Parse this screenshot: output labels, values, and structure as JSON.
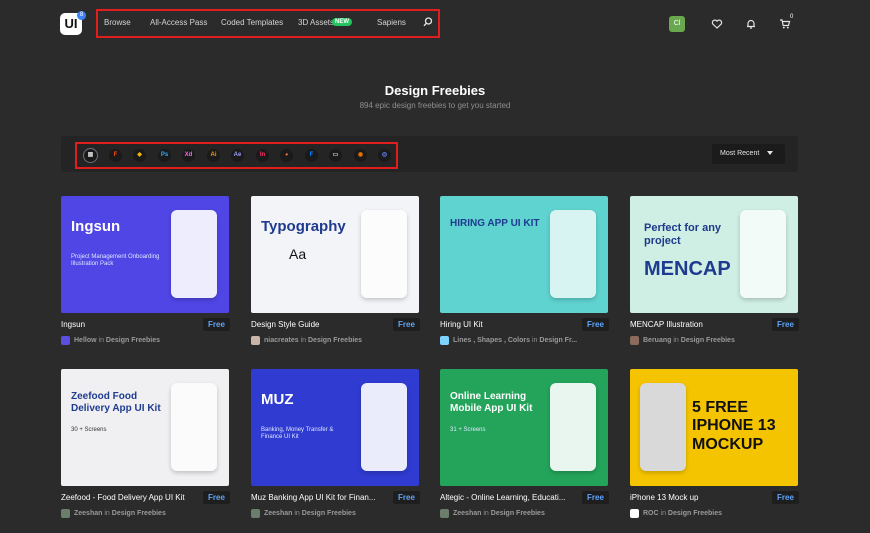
{
  "header": {
    "logo_text": "UI",
    "logo_badge": "8",
    "nav": [
      {
        "label": "Browse"
      },
      {
        "label": "All-Access Pass"
      },
      {
        "label": "Coded Templates"
      },
      {
        "label": "3D Assets"
      },
      {
        "label": "Sapiens"
      }
    ],
    "new_badge": "NEW",
    "search_icon": "search-icon",
    "avatar_initials": "Cl",
    "cart_count": "0",
    "icons": [
      "heart-icon",
      "bell-icon",
      "cart-icon"
    ]
  },
  "hero": {
    "title": "Design Freebies",
    "subtitle": "894 epic design freebies to get you started"
  },
  "filters": {
    "items": [
      {
        "icon": "grid-icon",
        "glyph": "▦",
        "color": "#cfcfcf"
      },
      {
        "icon": "figma-icon",
        "glyph": "F",
        "color": "#f24e1e"
      },
      {
        "icon": "sketch-icon",
        "glyph": "◆",
        "color": "#f7b500"
      },
      {
        "icon": "photoshop-icon",
        "glyph": "Ps",
        "color": "#31a8ff"
      },
      {
        "icon": "xd-icon",
        "glyph": "Xd",
        "color": "#ff61f6"
      },
      {
        "icon": "illustrator-icon",
        "glyph": "Ai",
        "color": "#ff9a00"
      },
      {
        "icon": "after-effects-icon",
        "glyph": "Ae",
        "color": "#9999ff"
      },
      {
        "icon": "invision-icon",
        "glyph": "In",
        "color": "#ff3366"
      },
      {
        "icon": "pie-icon",
        "glyph": "◕",
        "color": "#ff7a45"
      },
      {
        "icon": "framer-icon",
        "glyph": "F",
        "color": "#0a84ff"
      },
      {
        "icon": "monitor-icon",
        "glyph": "▭",
        "color": "#cfcfcf"
      },
      {
        "icon": "blender-icon",
        "glyph": "◉",
        "color": "#ea7600"
      },
      {
        "icon": "circle-logo-icon",
        "glyph": "◎",
        "color": "#6b8cff"
      }
    ],
    "sort_label": "Most Recent"
  },
  "cards": [
    {
      "title": "Ingsun",
      "price": "Free",
      "author": "Hellow",
      "in_word": "in",
      "category": "Design Freebies",
      "bg": "#4f46e5",
      "avatar_color": "#5b4fe0",
      "thumb_text": "Ingsun",
      "thumb_sub": "Project Management Onboarding Illustration Pack"
    },
    {
      "title": "Design Style Guide",
      "price": "Free",
      "author": "niacreates",
      "in_word": "in",
      "category": "Design Freebies",
      "bg": "#f2f4f8",
      "avatar_color": "#c9b6a8",
      "thumb_text": "Typography",
      "thumb_sub": "Aa"
    },
    {
      "title": "Hiring UI Kit",
      "price": "Free",
      "author": "Lines , Shapes , Colors",
      "in_word": "in",
      "category": "Design Fr...",
      "bg": "#5fd3d0",
      "avatar_color": "#7dd3fc",
      "thumb_text": "HIRING APP UI KIT",
      "thumb_sub": ""
    },
    {
      "title": "MENCAP Illustration",
      "price": "Free",
      "author": "Beruang",
      "in_word": "in",
      "category": "Design Freebies",
      "bg": "#cfeee4",
      "avatar_color": "#8b6b5c",
      "thumb_text": "MENCAP",
      "thumb_sub": "Perfect for any project"
    },
    {
      "title": "Zeefood - Food Delivery App UI Kit",
      "price": "Free",
      "author": "Zeeshan",
      "in_word": "in",
      "category": "Design Freebies",
      "bg": "#f0f0f2",
      "avatar_color": "#6b7d6b",
      "thumb_text": "Zeefood Food Delivery App UI Kit",
      "thumb_sub": "30 + Screens"
    },
    {
      "title": "Muz Banking App UI Kit for Finan...",
      "price": "Free",
      "author": "Zeeshan",
      "in_word": "in",
      "category": "Design Freebies",
      "bg": "#2f3bd1",
      "avatar_color": "#6b7d6b",
      "thumb_text": "MUZ",
      "thumb_sub": "Banking, Money Transfer & Finance UI Kit"
    },
    {
      "title": "Altegic - Online Learning, Educati...",
      "price": "Free",
      "author": "Zeeshan",
      "in_word": "in",
      "category": "Design Freebies",
      "bg": "#23a45a",
      "avatar_color": "#6b7d6b",
      "thumb_text": "Online Learning Mobile App UI Kit",
      "thumb_sub": "31 + Screens"
    },
    {
      "title": "iPhone 13 Mock up",
      "price": "Free",
      "author": "ROC",
      "in_word": "in",
      "category": "Design Freebies",
      "bg": "#f5c400",
      "avatar_color": "#ffffff",
      "thumb_text": "5 FREE IPHONE 13 MOCKUP",
      "thumb_sub": ""
    }
  ]
}
